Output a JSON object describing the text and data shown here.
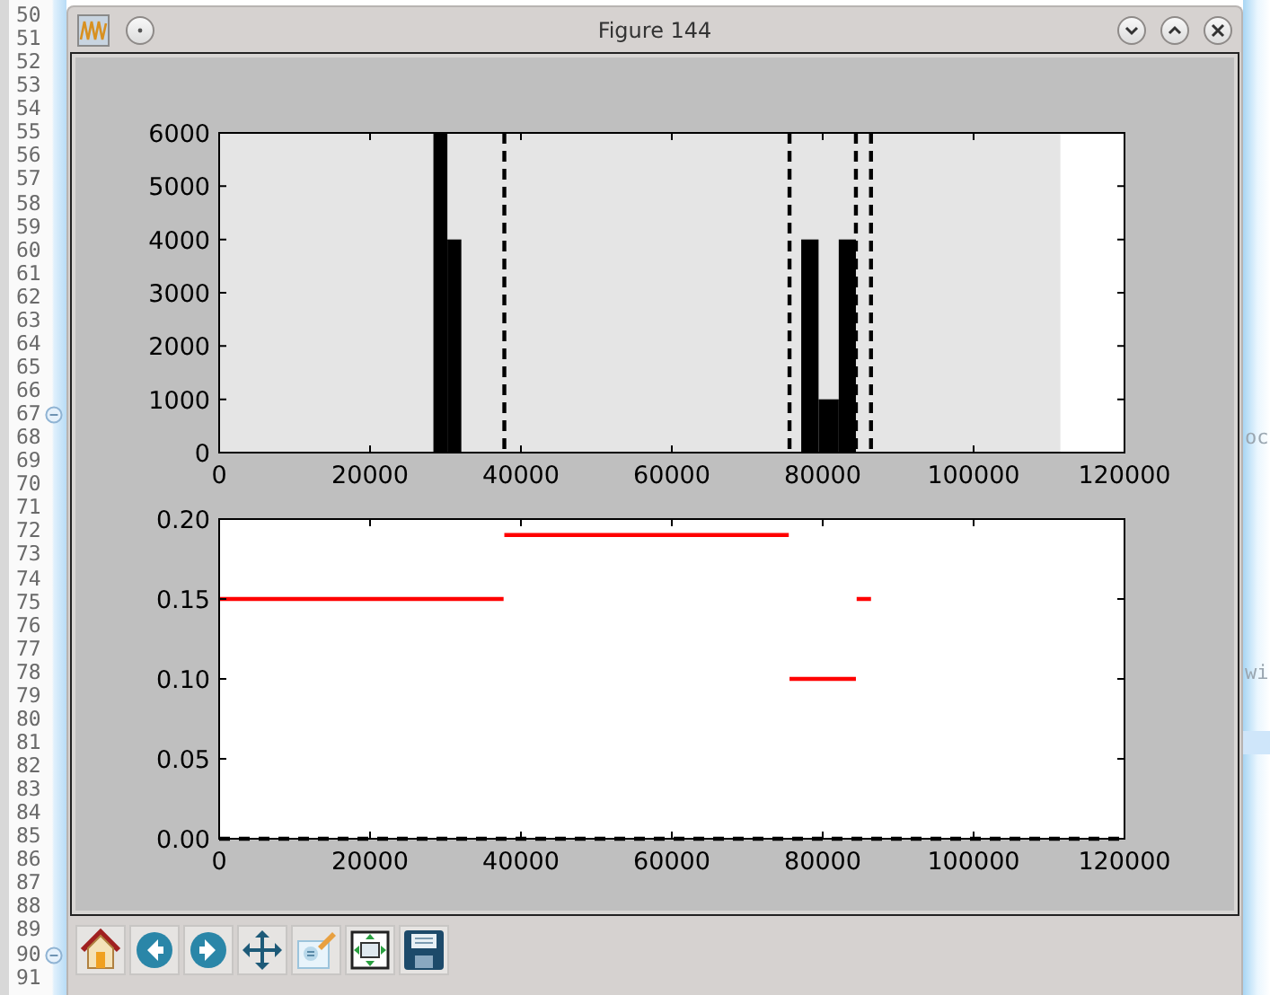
{
  "editor": {
    "lines": [
      {
        "number": "50",
        "fold": false,
        "current": false
      },
      {
        "number": "51",
        "fold": false,
        "current": false
      },
      {
        "number": "52",
        "fold": false,
        "current": false
      },
      {
        "number": "53",
        "fold": false,
        "current": false
      },
      {
        "number": "54",
        "fold": false,
        "current": false
      },
      {
        "number": "55",
        "fold": false,
        "current": false
      },
      {
        "number": "56",
        "fold": false,
        "current": false
      },
      {
        "number": "57",
        "fold": false,
        "current": false
      },
      {
        "number": "58",
        "fold": false,
        "current": false
      },
      {
        "number": "59",
        "fold": false,
        "current": false
      },
      {
        "number": "60",
        "fold": false,
        "current": false
      },
      {
        "number": "61",
        "fold": false,
        "current": false
      },
      {
        "number": "62",
        "fold": false,
        "current": false
      },
      {
        "number": "63",
        "fold": false,
        "current": false
      },
      {
        "number": "64",
        "fold": false,
        "current": false
      },
      {
        "number": "65",
        "fold": false,
        "current": false
      },
      {
        "number": "66",
        "fold": false,
        "current": false
      },
      {
        "number": "67",
        "fold": true,
        "current": false
      },
      {
        "number": "68",
        "fold": false,
        "current": false,
        "tail": "oc"
      },
      {
        "number": "69",
        "fold": false,
        "current": false
      },
      {
        "number": "70",
        "fold": false,
        "current": false
      },
      {
        "number": "71",
        "fold": false,
        "current": false
      },
      {
        "number": "72",
        "fold": false,
        "current": false
      },
      {
        "number": "73",
        "fold": false,
        "current": false
      },
      {
        "number": "74",
        "fold": false,
        "current": false
      },
      {
        "number": "75",
        "fold": false,
        "current": false
      },
      {
        "number": "76",
        "fold": false,
        "current": false
      },
      {
        "number": "77",
        "fold": false,
        "current": false
      },
      {
        "number": "78",
        "fold": false,
        "current": false,
        "tail": "wi"
      },
      {
        "number": "79",
        "fold": false,
        "current": false
      },
      {
        "number": "80",
        "fold": false,
        "current": false
      },
      {
        "number": "81",
        "fold": false,
        "current": true
      },
      {
        "number": "82",
        "fold": false,
        "current": false
      },
      {
        "number": "83",
        "fold": false,
        "current": false
      },
      {
        "number": "84",
        "fold": false,
        "current": false
      },
      {
        "number": "85",
        "fold": false,
        "current": false
      },
      {
        "number": "86",
        "fold": false,
        "current": false
      },
      {
        "number": "87",
        "fold": false,
        "current": false
      },
      {
        "number": "88",
        "fold": false,
        "current": false
      },
      {
        "number": "89",
        "fold": false,
        "current": false
      },
      {
        "number": "90",
        "fold": true,
        "current": false
      },
      {
        "number": "91",
        "fold": false,
        "current": false
      }
    ]
  },
  "window": {
    "title": "Figure 144"
  },
  "figure": {
    "subplots": [
      {
        "chart_data": {
          "type": "bar",
          "x": [
            29350,
            31150,
            78100,
            80800,
            83450
          ],
          "values": [
            6000,
            4000,
            4000,
            1000,
            4000
          ],
          "xlim": [
            0,
            120000
          ],
          "ylim": [
            0,
            6000
          ],
          "xticks": [
            0,
            20000,
            40000,
            60000,
            80000,
            100000,
            120000
          ],
          "yticks": [
            0,
            1000,
            2000,
            3000,
            4000,
            5000,
            6000
          ],
          "bands": [
            {
              "axis": "x",
              "from": 0,
              "to": 111500
            }
          ],
          "ref_lines": [
            {
              "axis": "x",
              "value": 37800,
              "line_style": "dashed"
            },
            {
              "axis": "x",
              "value": 75600,
              "line_style": "dashed"
            },
            {
              "axis": "x",
              "value": 84400,
              "line_style": "dashed"
            },
            {
              "axis": "x",
              "value": 86400,
              "line_style": "dashed"
            }
          ]
        }
      },
      {
        "chart_data": {
          "type": "line",
          "x": [
            0,
            37700,
            37750,
            37800,
            75500,
            75550,
            75600,
            84400,
            84450,
            84500,
            86400,
            120000
          ],
          "xlim": [
            0,
            120000
          ],
          "ylim": [
            0,
            0.2
          ],
          "series": [
            {
              "color": "#ff0000",
              "line_style": "solid",
              "values": [
                0.15,
                0.15,
                null,
                0.19,
                0.19,
                null,
                0.1,
                0.1,
                null,
                0.15,
                0.15,
                null
              ]
            },
            {
              "color": "#000000",
              "line_style": "dashed",
              "values": [
                0,
                0,
                0,
                0,
                0,
                0,
                0,
                0,
                0,
                0,
                0,
                0
              ]
            }
          ],
          "xticks": [
            0,
            20000,
            40000,
            60000,
            80000,
            100000,
            120000
          ],
          "yticks": [
            {
              "value": 0,
              "label": "0.00"
            },
            {
              "value": 0.05,
              "label": "0.05"
            },
            {
              "value": 0.1,
              "label": "0.10"
            },
            {
              "value": 0.15,
              "label": "0.15"
            },
            {
              "value": 0.2,
              "label": "0.20"
            }
          ]
        }
      }
    ]
  }
}
